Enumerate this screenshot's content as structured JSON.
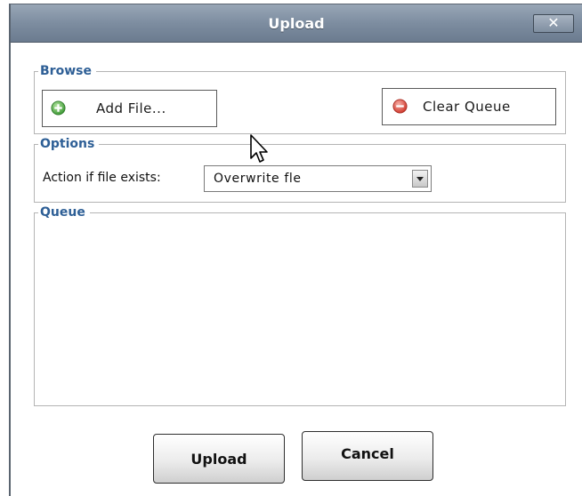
{
  "window": {
    "title": "Upload",
    "close_label": "✕"
  },
  "browse": {
    "legend": "Browse",
    "add_file_label": "Add File...",
    "clear_queue_label": "Clear Queue"
  },
  "options": {
    "legend": "Options",
    "action_label": "Action if file exists:",
    "action_value": "Overwrite fle"
  },
  "queue": {
    "legend": "Queue"
  },
  "footer": {
    "upload_label": "Upload",
    "cancel_label": "Cancel"
  },
  "icons": {
    "add": "plus-circle-icon",
    "clear": "minus-circle-icon",
    "close": "close-icon",
    "dropdown": "chevron-down-icon",
    "cursor": "mouse-pointer-icon"
  },
  "colors": {
    "legend_text": "#2e5f96",
    "titlebar": "#7d8da0",
    "add_icon": "#5cb85c",
    "clear_icon": "#e05050"
  }
}
